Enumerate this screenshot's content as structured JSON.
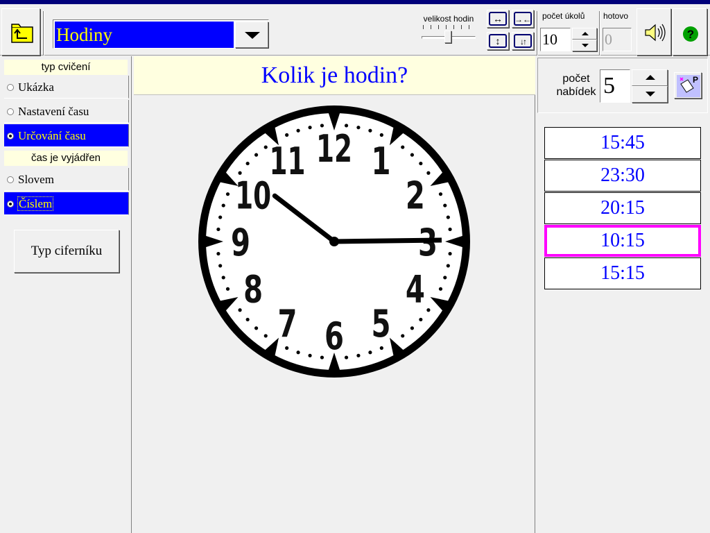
{
  "toolbar": {
    "title": "Hodiny",
    "size_label": "velikost hodin",
    "tasks_label": "počet úkolů",
    "tasks_value": "10",
    "done_label": "hotovo",
    "done_value": "0",
    "size_buttons": [
      "↔",
      "→←",
      "↕",
      "↓↑"
    ]
  },
  "left": {
    "exercise_heading": "typ cvičení",
    "exercise_types": [
      {
        "label": "Ukázka",
        "selected": false
      },
      {
        "label": "Nastavení času",
        "selected": false
      },
      {
        "label": "Určování času",
        "selected": true
      }
    ],
    "time_heading": "čas je vyjádřen",
    "time_modes": [
      {
        "label": "Slovem",
        "selected": false
      },
      {
        "label": "Číslem",
        "selected": true
      }
    ],
    "dial_button": "Typ ciferníku"
  },
  "center": {
    "question": "Kolik je hodin?",
    "clock": {
      "numerals": [
        "12",
        "1",
        "2",
        "3",
        "4",
        "5",
        "6",
        "7",
        "8",
        "9",
        "10",
        "11"
      ],
      "hour": 10,
      "minute": 15
    }
  },
  "right": {
    "offers_label_line1": "počet",
    "offers_label_line2": "nabídek",
    "offers_value": "5",
    "p_button": "P",
    "answers": [
      {
        "text": "15:45",
        "chosen": false
      },
      {
        "text": "23:30",
        "chosen": false
      },
      {
        "text": "20:15",
        "chosen": false
      },
      {
        "text": "10:15",
        "chosen": true
      },
      {
        "text": "15:15",
        "chosen": false
      }
    ]
  },
  "colors": {
    "selected_bg": "#0000ff",
    "selected_text": "#ffff00",
    "header_bg": "#ffffe0",
    "answer_text": "#0000ff",
    "chosen_border": "#ff00ff"
  }
}
